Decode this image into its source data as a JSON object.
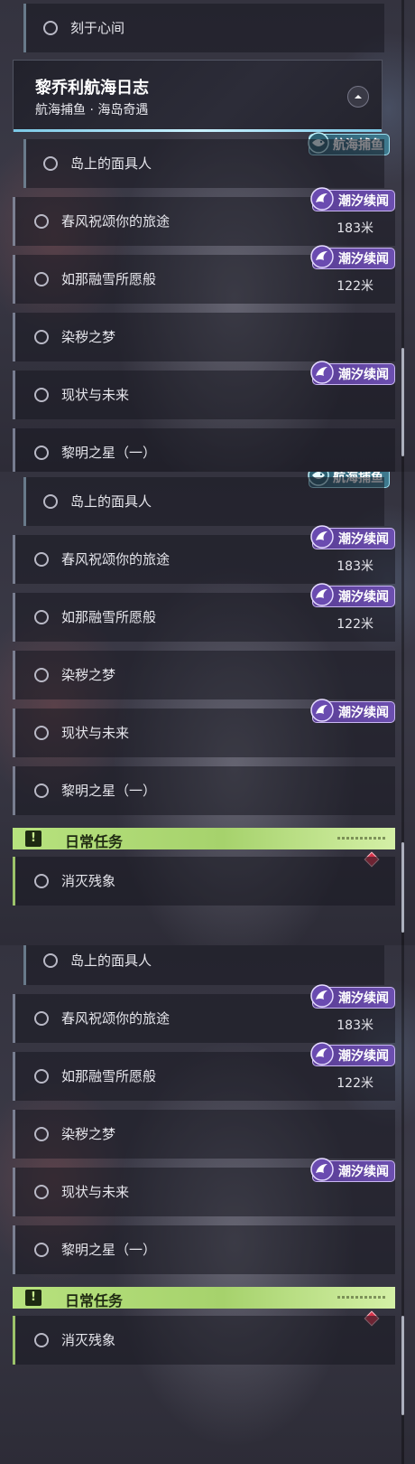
{
  "top_item": "刻于心间",
  "chapter": {
    "title": "黎乔利航海日志",
    "subtitle": "航海捕鱼 · 海岛奇遇",
    "collapse_icon": "chevron-up-icon"
  },
  "tags": {
    "fishing": "航海捕鱼",
    "tide": "潮汐续闻"
  },
  "quests": {
    "mask": "岛上的面具人",
    "spring": "春风祝颂你的旅途",
    "snow": "如那融雪所愿般",
    "dream": "染秽之梦",
    "future": "现状与未来",
    "dawn": "黎明之星（一）",
    "dawn_cut": "黎明之星（一）",
    "daily_header": "日常任务",
    "daily_item": "消灭残象"
  },
  "distances": {
    "spring": "183米",
    "snow": "122米"
  },
  "colors": {
    "tide_tag": "#6c4fb0",
    "fishing_tag": "#3e7a8f",
    "daily_banner": "#b7e27e",
    "tracking_marker": "#d6334a"
  }
}
